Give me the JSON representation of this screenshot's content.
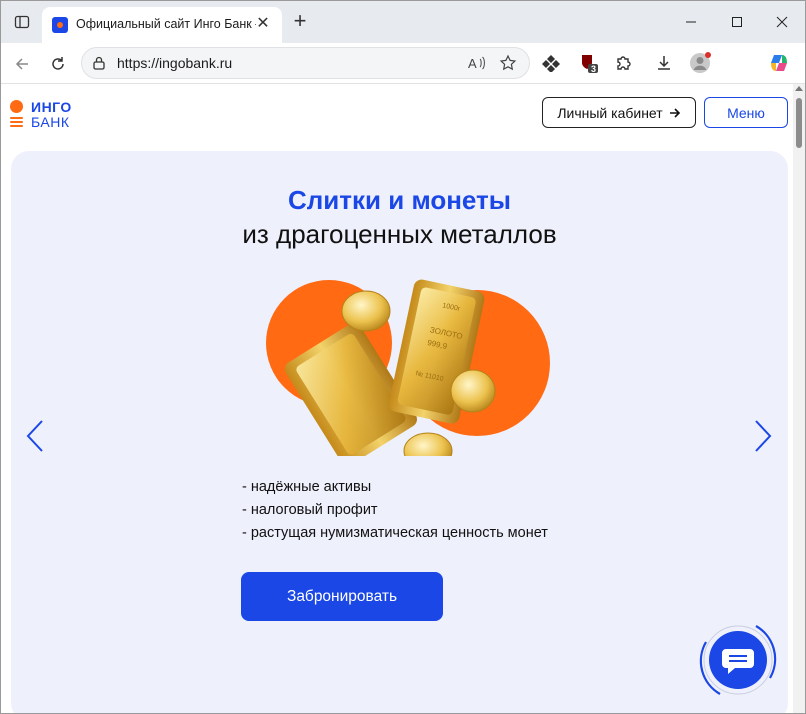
{
  "browser": {
    "tab_title": "Официальный сайт Инго Банк –",
    "url": "https://ingobank.ru",
    "extension_badge": "3",
    "icons": {
      "sidebar": "sidebar-toggle-icon",
      "close_tab": "close-icon",
      "new_tab": "plus-icon",
      "minimize": "minimize-icon",
      "maximize": "maximize-icon",
      "close_window": "close-icon",
      "back": "back-arrow-icon",
      "refresh": "refresh-icon",
      "lock": "lock-icon",
      "read_aloud": "read-aloud-icon",
      "favorite": "star-icon",
      "extension1": "diamond-extension-icon",
      "extension2": "ublock-icon",
      "extensions": "puzzle-icon",
      "downloads": "download-icon",
      "profile": "avatar-icon",
      "copilot": "copilot-icon"
    }
  },
  "site": {
    "logo_line1": "ИНГО",
    "logo_line2": "БАНК",
    "cabinet_button": "Личный кабинет",
    "menu_button": "Меню",
    "hero": {
      "title_highlight": "Слитки и монеты",
      "title_rest": "из драгоценных металлов",
      "bullets": [
        "- надёжные активы",
        "- налоговый профит",
        "- растущая нумизматическая ценность монет"
      ],
      "cta": "Забронировать",
      "bar_text_1": "ЗОЛОТО",
      "bar_text_2": "999,9",
      "bar_text_3": "№ 11010",
      "bar_text_4": "1000г"
    },
    "colors": {
      "brand_blue": "#1a47e5",
      "brand_orange": "#ff6a13",
      "hero_bg": "#eef0fc"
    }
  }
}
